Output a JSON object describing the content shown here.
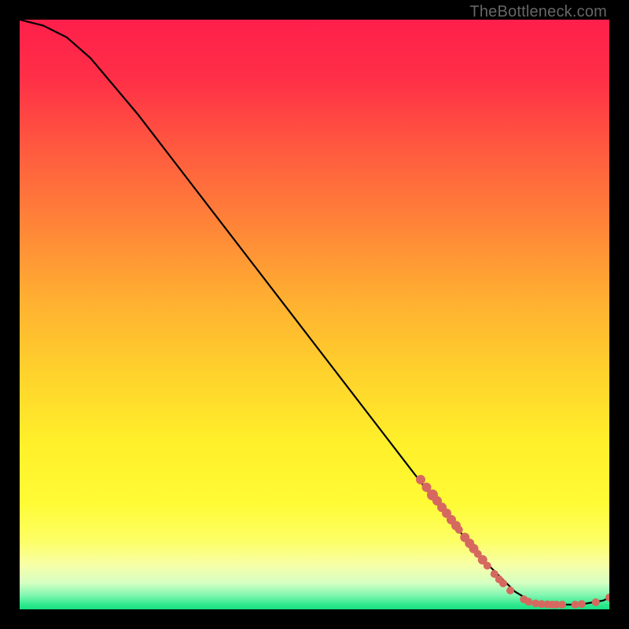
{
  "watermark": "TheBottleneck.com",
  "chart_data": {
    "type": "line",
    "title": "",
    "xlabel": "",
    "ylabel": "",
    "xlim": [
      0,
      100
    ],
    "ylim": [
      0,
      100
    ],
    "grid": false,
    "curve": [
      {
        "x": 0,
        "y": 100
      },
      {
        "x": 4,
        "y": 99
      },
      {
        "x": 8,
        "y": 97
      },
      {
        "x": 12,
        "y": 93.5
      },
      {
        "x": 20,
        "y": 84
      },
      {
        "x": 30,
        "y": 71
      },
      {
        "x": 40,
        "y": 58
      },
      {
        "x": 50,
        "y": 45
      },
      {
        "x": 60,
        "y": 32
      },
      {
        "x": 70,
        "y": 19
      },
      {
        "x": 78,
        "y": 9
      },
      {
        "x": 84,
        "y": 3
      },
      {
        "x": 87,
        "y": 1.2
      },
      {
        "x": 90,
        "y": 0.8
      },
      {
        "x": 95,
        "y": 0.8
      },
      {
        "x": 99,
        "y": 1.5
      },
      {
        "x": 100,
        "y": 2
      }
    ],
    "scatter": [
      {
        "x": 68,
        "y": 22,
        "r": 6
      },
      {
        "x": 69,
        "y": 20.7,
        "r": 6
      },
      {
        "x": 70,
        "y": 19.4,
        "r": 7
      },
      {
        "x": 70.8,
        "y": 18.4,
        "r": 6
      },
      {
        "x": 71.6,
        "y": 17.3,
        "r": 6
      },
      {
        "x": 72.4,
        "y": 16.3,
        "r": 6
      },
      {
        "x": 73.2,
        "y": 15.2,
        "r": 6
      },
      {
        "x": 74,
        "y": 14.2,
        "r": 6
      },
      {
        "x": 74.5,
        "y": 13.5,
        "r": 5
      },
      {
        "x": 75.5,
        "y": 12.2,
        "r": 6
      },
      {
        "x": 76.3,
        "y": 11.2,
        "r": 6
      },
      {
        "x": 77,
        "y": 10.3,
        "r": 6
      },
      {
        "x": 77.7,
        "y": 9.4,
        "r": 5
      },
      {
        "x": 78.5,
        "y": 8.4,
        "r": 6
      },
      {
        "x": 79.3,
        "y": 7.4,
        "r": 5
      },
      {
        "x": 80.5,
        "y": 6,
        "r": 5
      },
      {
        "x": 81.3,
        "y": 5.1,
        "r": 5
      },
      {
        "x": 82,
        "y": 4.4,
        "r": 5
      },
      {
        "x": 83.2,
        "y": 3.2,
        "r": 5
      },
      {
        "x": 85.5,
        "y": 1.7,
        "r": 5
      },
      {
        "x": 86.3,
        "y": 1.3,
        "r": 5
      },
      {
        "x": 87.5,
        "y": 1.0,
        "r": 5
      },
      {
        "x": 88.5,
        "y": 0.9,
        "r": 5
      },
      {
        "x": 89.5,
        "y": 0.85,
        "r": 5
      },
      {
        "x": 90.3,
        "y": 0.8,
        "r": 5
      },
      {
        "x": 91,
        "y": 0.8,
        "r": 5
      },
      {
        "x": 92,
        "y": 0.8,
        "r": 5
      },
      {
        "x": 94.2,
        "y": 0.8,
        "r": 5
      },
      {
        "x": 95.3,
        "y": 0.9,
        "r": 5
      },
      {
        "x": 97.7,
        "y": 1.2,
        "r": 5
      },
      {
        "x": 100,
        "y": 2.0,
        "r": 5
      }
    ],
    "gradient_stops": [
      {
        "offset": 0.0,
        "color": "#ff1f4b"
      },
      {
        "offset": 0.1,
        "color": "#ff2f47"
      },
      {
        "offset": 0.22,
        "color": "#ff5a3f"
      },
      {
        "offset": 0.35,
        "color": "#ff8538"
      },
      {
        "offset": 0.48,
        "color": "#ffb131"
      },
      {
        "offset": 0.6,
        "color": "#ffd22c"
      },
      {
        "offset": 0.72,
        "color": "#fff02a"
      },
      {
        "offset": 0.82,
        "color": "#fffb35"
      },
      {
        "offset": 0.885,
        "color": "#fdff66"
      },
      {
        "offset": 0.925,
        "color": "#f7ffa8"
      },
      {
        "offset": 0.955,
        "color": "#d6ffc2"
      },
      {
        "offset": 0.975,
        "color": "#86f7b2"
      },
      {
        "offset": 0.992,
        "color": "#2fe98e"
      },
      {
        "offset": 1.0,
        "color": "#18df82"
      }
    ],
    "scatter_color": "#d6695f",
    "line_color": "#000000"
  }
}
